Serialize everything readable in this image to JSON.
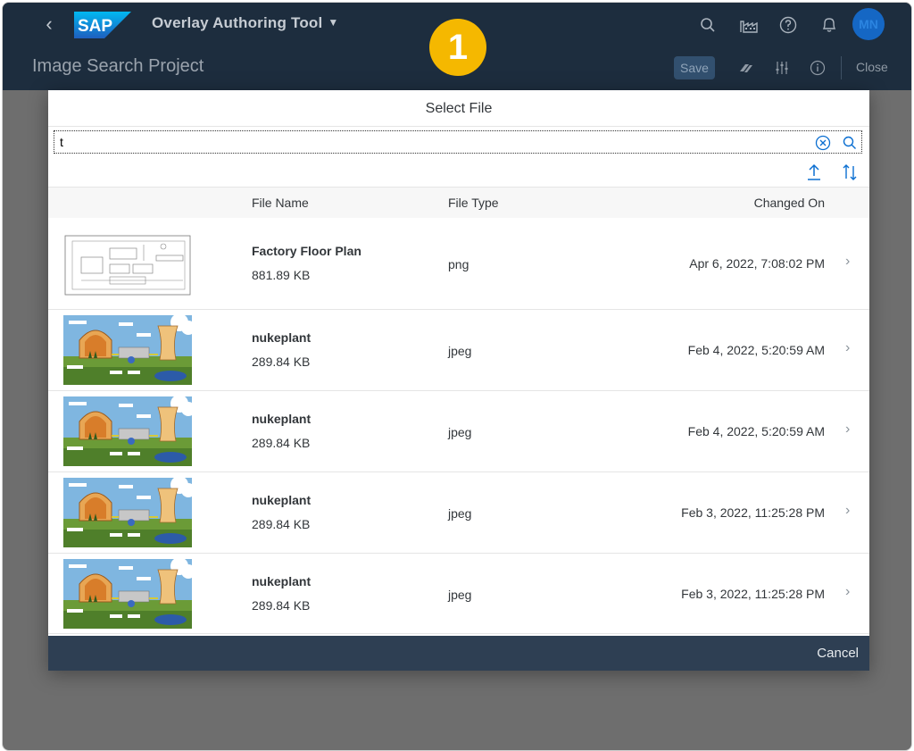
{
  "shell": {
    "logo_text": "SAP",
    "app_title": "Overlay Authoring Tool",
    "avatar_initials": "MN",
    "step_number": "1"
  },
  "subheader": {
    "page_title": "Image Search Project",
    "save_label": "Save",
    "close_label": "Close"
  },
  "dialog": {
    "title": "Select File",
    "search": {
      "value": "t",
      "placeholder": ""
    },
    "columns": {
      "name": "File Name",
      "type": "File Type",
      "changed": "Changed On"
    },
    "files": [
      {
        "name": "Factory Floor Plan",
        "size": "881.89 KB",
        "type": "png",
        "changed": "Apr 6, 2022, 7:08:02 PM",
        "thumb": "floorplan"
      },
      {
        "name": "nukeplant",
        "size": "289.84 KB",
        "type": "jpeg",
        "changed": "Feb 4, 2022, 5:20:59 AM",
        "thumb": "plant"
      },
      {
        "name": "nukeplant",
        "size": "289.84 KB",
        "type": "jpeg",
        "changed": "Feb 4, 2022, 5:20:59 AM",
        "thumb": "plant"
      },
      {
        "name": "nukeplant",
        "size": "289.84 KB",
        "type": "jpeg",
        "changed": "Feb 3, 2022, 11:25:28 PM",
        "thumb": "plant"
      },
      {
        "name": "nukeplant",
        "size": "289.84 KB",
        "type": "jpeg",
        "changed": "Feb 3, 2022, 11:25:28 PM",
        "thumb": "plant"
      }
    ],
    "cancel_label": "Cancel"
  },
  "colors": {
    "shell_bg": "#1d2d3e",
    "footer_bg": "#2e3f53",
    "accent": "#0a6ed1",
    "badge": "#f5b800"
  }
}
